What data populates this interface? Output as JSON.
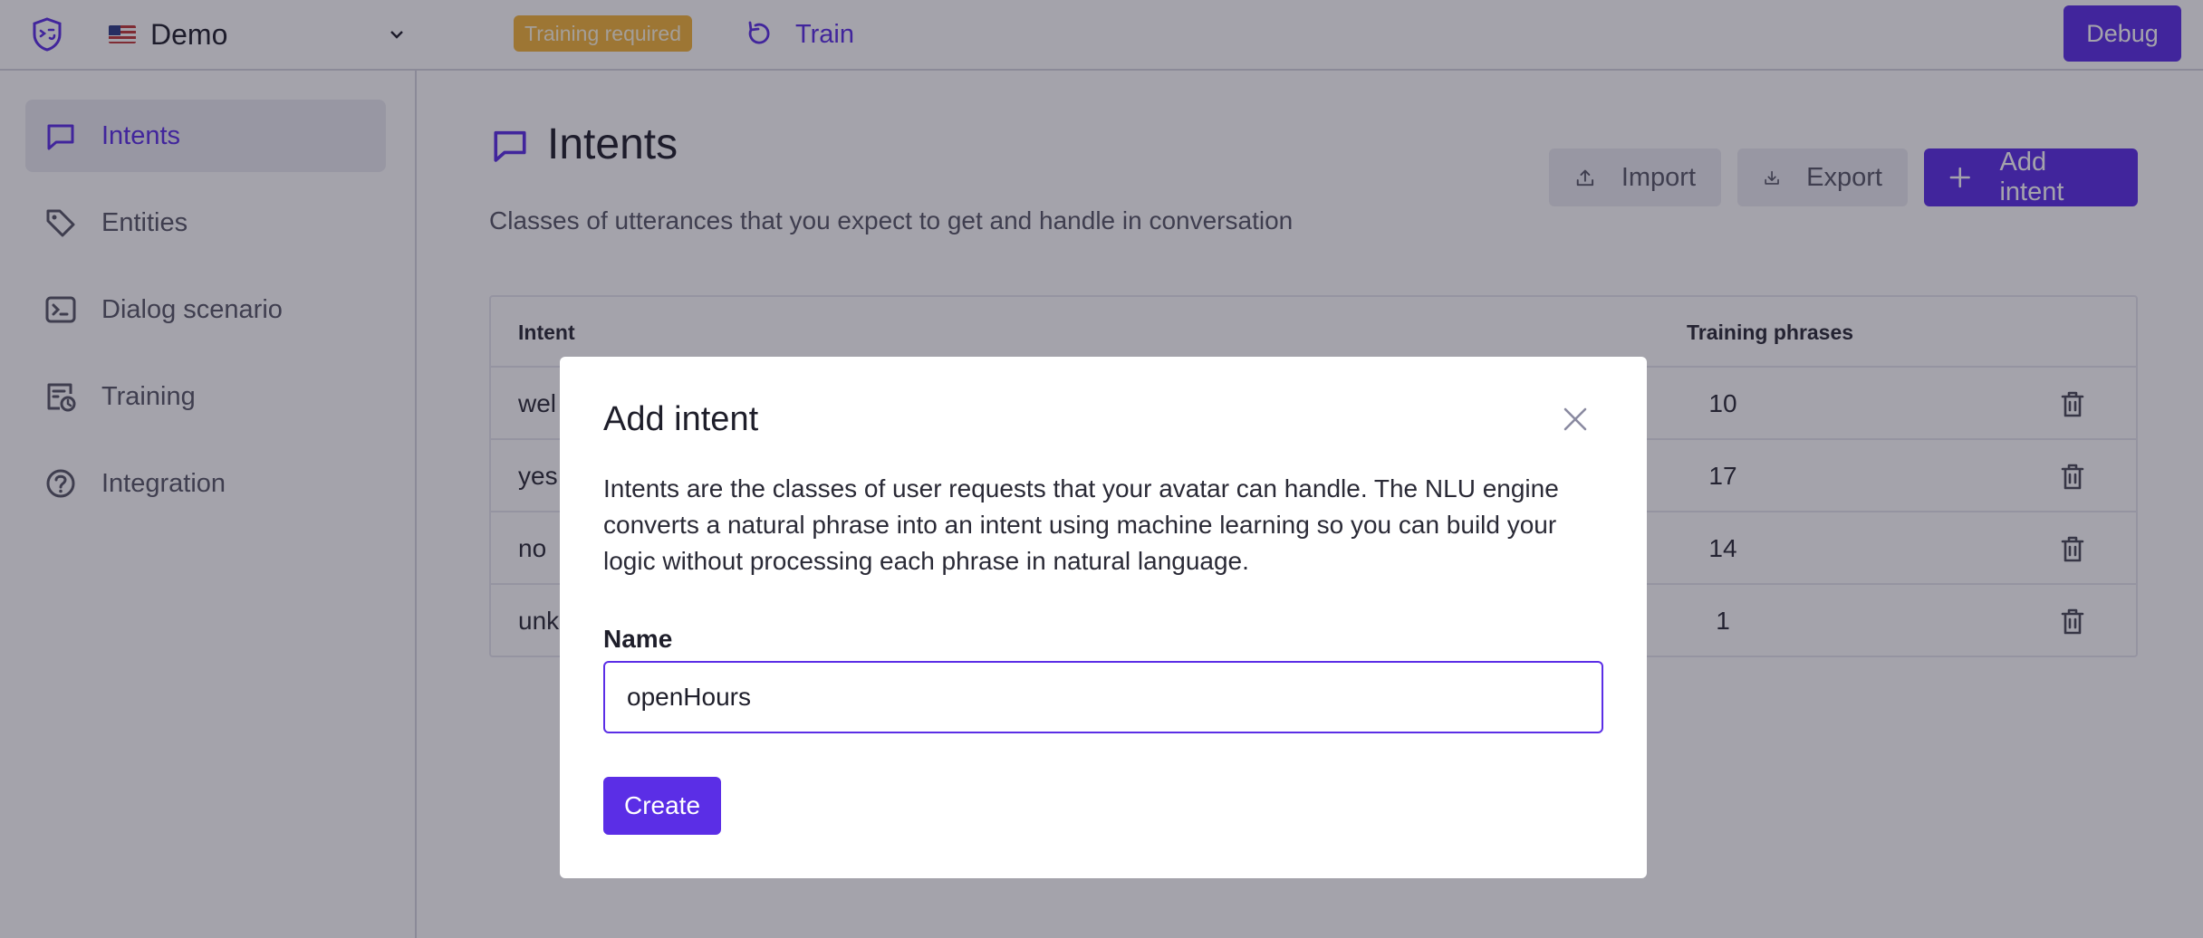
{
  "topbar": {
    "project_name": "Demo",
    "badge": "Training required",
    "train_label": "Train",
    "debug_label": "Debug"
  },
  "sidebar": {
    "items": [
      {
        "label": "Intents",
        "icon": "chat-icon",
        "active": true
      },
      {
        "label": "Entities",
        "icon": "tag-icon",
        "active": false
      },
      {
        "label": "Dialog scenario",
        "icon": "terminal-icon",
        "active": false
      },
      {
        "label": "Training",
        "icon": "training-icon",
        "active": false
      },
      {
        "label": "Integration",
        "icon": "help-circle-icon",
        "active": false
      }
    ]
  },
  "main": {
    "title": "Intents",
    "subtitle": "Classes of utterances that you expect to get and handle in conversation",
    "import_label": "Import",
    "export_label": "Export",
    "add_label": "Add intent",
    "table": {
      "col_intent": "Intent",
      "col_phrases": "Training phrases",
      "rows": [
        {
          "name": "wel",
          "count": "10"
        },
        {
          "name": "yes",
          "count": "17"
        },
        {
          "name": "no",
          "count": "14"
        },
        {
          "name": "unk",
          "count": "1"
        }
      ]
    }
  },
  "modal": {
    "title": "Add intent",
    "description": "Intents are the classes of user requests that your avatar can handle. The NLU engine converts a natural phrase into an intent using machine learning so you can build your logic without processing each phrase in natural language.",
    "name_label": "Name",
    "name_value": "openHours",
    "create_label": "Create"
  },
  "colors": {
    "accent": "#5b2ee6",
    "badge": "#f3b53a",
    "overlay": "rgba(28,26,46,0.40)"
  }
}
